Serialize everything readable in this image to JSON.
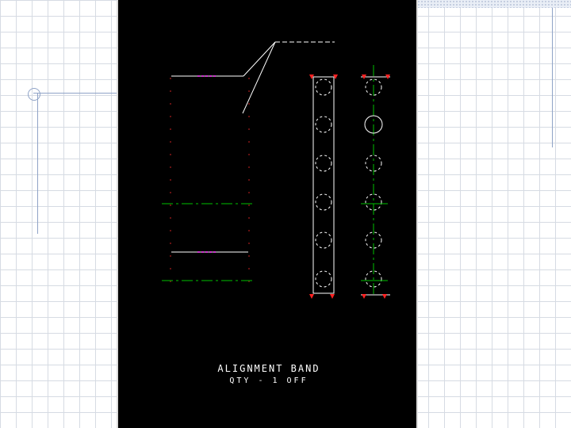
{
  "drawing": {
    "title": "ALIGNMENT  BAND",
    "subtitle": "QTY - 1 OFF",
    "callout": "",
    "colors": {
      "background": "#000000",
      "outline": "#ffffff",
      "center_line": "#00c000",
      "hidden_line": "#cc2222",
      "hatch": "#cc33cc",
      "arrow": "#ff2222"
    }
  }
}
